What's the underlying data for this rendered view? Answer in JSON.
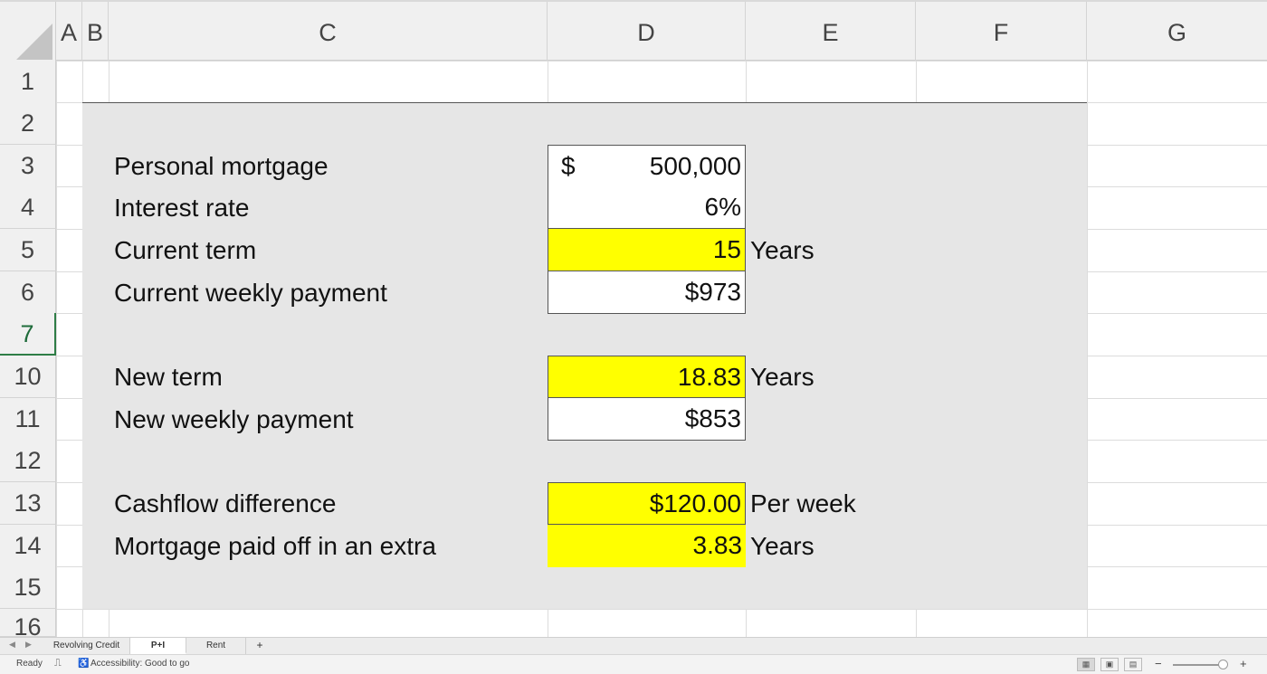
{
  "columns": [
    "A",
    "B",
    "C",
    "D",
    "E",
    "F",
    "G"
  ],
  "rows": [
    "1",
    "2",
    "3",
    "4",
    "5",
    "6",
    "7",
    "10",
    "11",
    "12",
    "13",
    "14",
    "15",
    "16"
  ],
  "sheet": {
    "mortgage": {
      "label": "Personal mortgage",
      "currency": "$",
      "value": "500,000"
    },
    "rate": {
      "label": "Interest rate",
      "value": "6%"
    },
    "term": {
      "label": "Current term",
      "value": "15",
      "unit": "Years"
    },
    "weekly": {
      "label": "Current weekly payment",
      "value": "$973"
    },
    "new_term": {
      "label": "New term",
      "value": "18.83",
      "unit": "Years"
    },
    "new_weekly": {
      "label": "New weekly payment",
      "value": "$853"
    },
    "cashflow": {
      "label": "Cashflow difference",
      "value": "$120.00",
      "unit": "Per week"
    },
    "paid_off": {
      "label": "Mortgage paid off in an extra",
      "value": "3.83",
      "unit": "Years"
    }
  },
  "tabs": [
    {
      "label": "Revolving Credit",
      "active": false
    },
    {
      "label": "P+I",
      "active": true
    },
    {
      "label": "Rent",
      "active": false
    }
  ],
  "tab_add": "+",
  "status": {
    "ready": "Ready",
    "accessibility": "Accessibility: Good to go",
    "zoom_minus": "−",
    "zoom_plus": "+"
  },
  "colors": {
    "highlight": "#ffff00",
    "panel": "#e6e6e6",
    "selected_row": "#2e7d46"
  }
}
